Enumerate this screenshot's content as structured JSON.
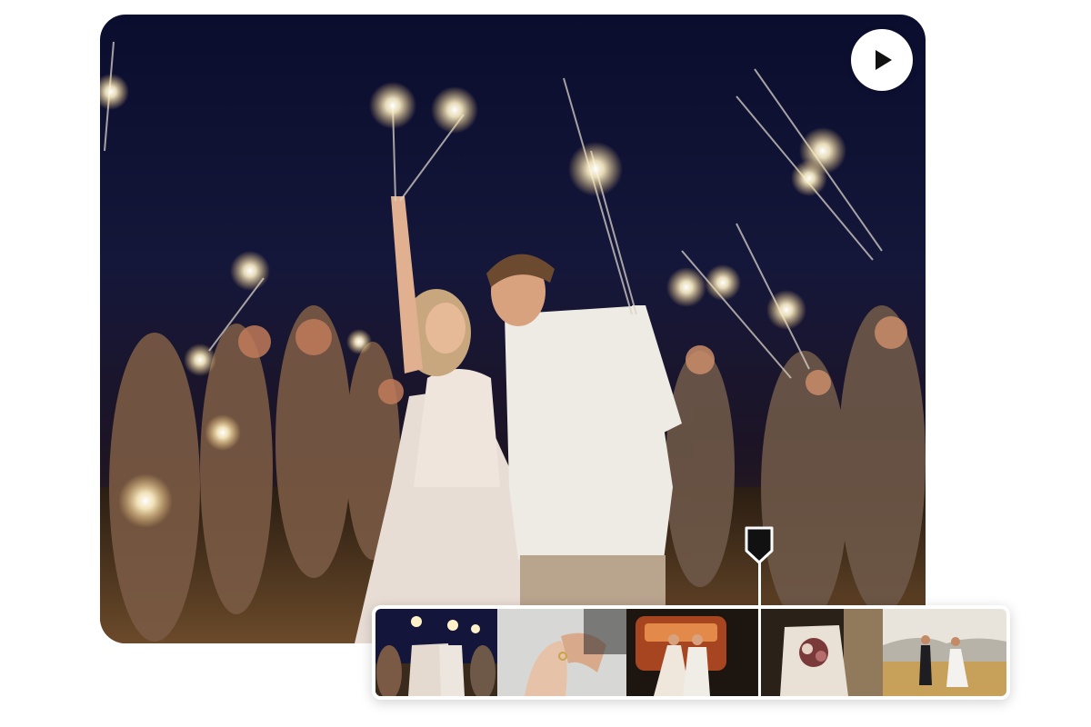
{
  "preview": {
    "title": "sparkler-send-off-photo",
    "play_icon": "play-icon"
  },
  "timeline": {
    "frames": [
      {
        "name": "frame-sparklers-night",
        "scene": "sparklers"
      },
      {
        "name": "frame-ring-hands",
        "scene": "rings"
      },
      {
        "name": "frame-couple-van",
        "scene": "van"
      },
      {
        "name": "frame-bouquet",
        "scene": "bouquet"
      },
      {
        "name": "frame-couple-field",
        "scene": "field"
      }
    ],
    "playhead_icon": "playhead-marker-icon"
  },
  "colors": {
    "night_sky": "#0b0d2e",
    "accent": "#111111"
  }
}
